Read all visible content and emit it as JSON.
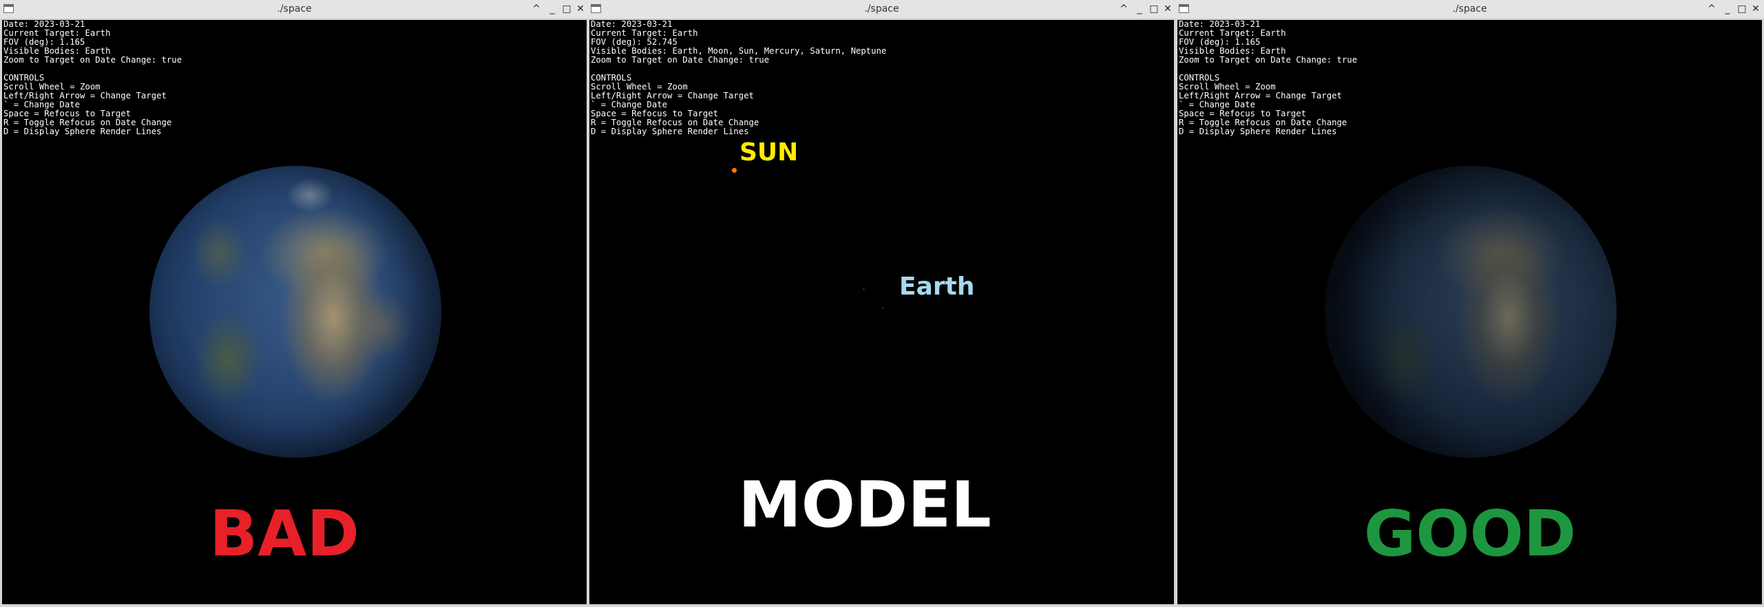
{
  "windows": [
    {
      "id": "left",
      "title": "./space",
      "hud": {
        "date": "Date: 2023-03-21",
        "target": "Current Target: Earth",
        "fov": "FOV (deg): 1.165",
        "visible": "Visible Bodies: Earth",
        "zoom": "Zoom to Target on Date Change: true",
        "controls_header": "CONTROLS",
        "controls": [
          "Scroll Wheel = Zoom",
          "Left/Right Arrow = Change Target",
          "` = Change Date",
          "Space = Refocus to Target",
          "R = Toggle Refocus on Date Change",
          "D = Display Sphere Render Lines"
        ]
      },
      "overlay_label": "BAD",
      "overlay_color": "#e8202a"
    },
    {
      "id": "middle",
      "title": "./space",
      "hud": {
        "date": "Date: 2023-03-21",
        "target": "Current Target: Earth",
        "fov": "FOV (deg): 52.745",
        "visible": "Visible Bodies: Earth, Moon, Sun, Mercury, Saturn, Neptune",
        "zoom": "Zoom to Target on Date Change: true",
        "controls_header": "CONTROLS",
        "controls": [
          "Scroll Wheel = Zoom",
          "Left/Right Arrow = Change Target",
          "` = Change Date",
          "Space = Refocus to Target",
          "R = Toggle Refocus on Date Change",
          "D = Display Sphere Render Lines"
        ]
      },
      "sun_label": "SUN",
      "sun_color": "#ffeb00",
      "earth_label": "Earth",
      "earth_color": "#a8d8ee",
      "overlay_label": "MODEL",
      "overlay_color": "#ffffff"
    },
    {
      "id": "right",
      "title": "./space",
      "hud": {
        "date": "Date: 2023-03-21",
        "target": "Current Target: Earth",
        "fov": "FOV (deg): 1.165",
        "visible": "Visible Bodies: Earth",
        "zoom": "Zoom to Target on Date Change: true",
        "controls_header": "CONTROLS",
        "controls": [
          "Scroll Wheel = Zoom",
          "Left/Right Arrow = Change Target",
          "` = Change Date",
          "Space = Refocus to Target",
          "R = Toggle Refocus on Date Change",
          "D = Display Sphere Render Lines"
        ]
      },
      "overlay_label": "GOOD",
      "overlay_color": "#1e9640"
    }
  ],
  "window_controls": {
    "up": "^",
    "minimize": "_",
    "maximize": "□",
    "close": "✕"
  }
}
